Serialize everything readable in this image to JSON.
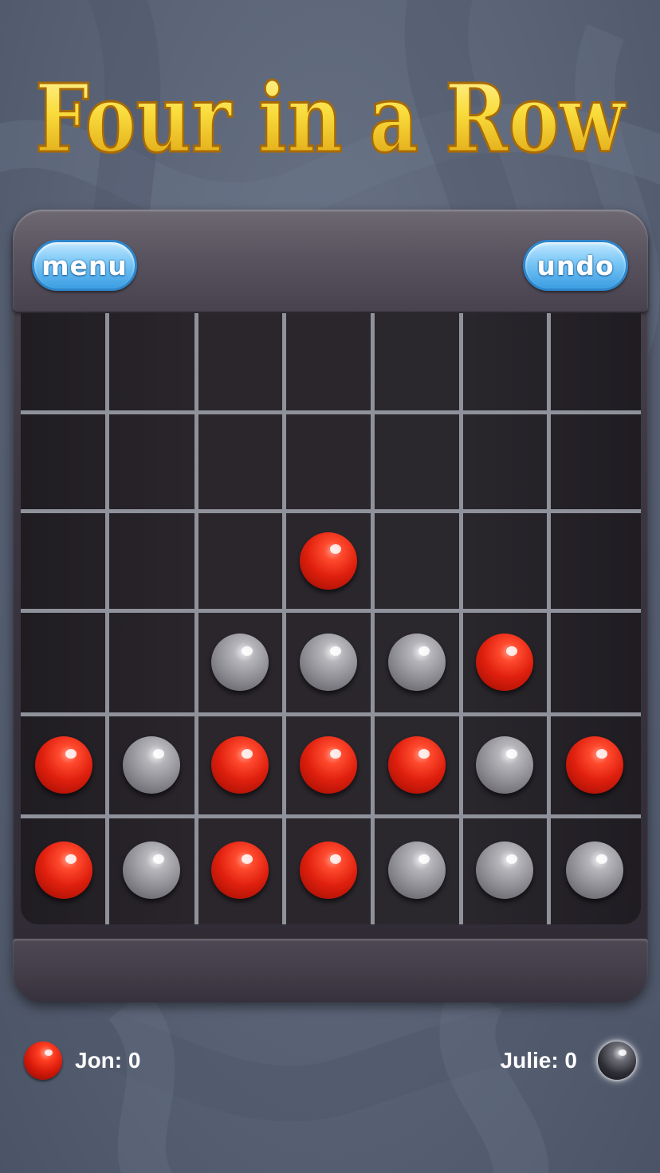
{
  "game": {
    "title": "Four in a Row",
    "menu_label": "menu",
    "undo_label": "undo"
  },
  "board": {
    "columns": 7,
    "rows": 6,
    "cells": [
      [
        "",
        "",
        "",
        "",
        "",
        "",
        ""
      ],
      [
        "",
        "",
        "",
        "",
        "",
        "",
        ""
      ],
      [
        "",
        "",
        "",
        "red",
        "",
        "",
        ""
      ],
      [
        "",
        "",
        "gray",
        "gray",
        "gray",
        "red",
        ""
      ],
      [
        "red",
        "gray",
        "red",
        "red",
        "red",
        "gray",
        "red"
      ],
      [
        "red",
        "gray",
        "red",
        "red",
        "gray",
        "gray",
        "gray"
      ]
    ]
  },
  "players": {
    "left": {
      "label": "Jon: 0",
      "piece_color": "red"
    },
    "right": {
      "label": "Julie: 0",
      "piece_color": "dark"
    }
  },
  "colors": {
    "title_gold": "#f6d53a",
    "button_blue": "#5db4f0",
    "red_piece": "#e0200e",
    "gray_piece": "#8c8c92",
    "grid_line": "#8f929b"
  }
}
